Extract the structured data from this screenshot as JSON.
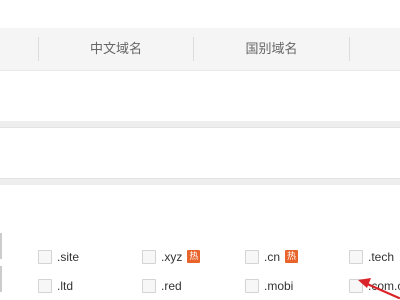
{
  "tabs": [
    {
      "label": ""
    },
    {
      "label": "中文域名"
    },
    {
      "label": "国别域名"
    },
    {
      "label": ""
    }
  ],
  "tlds": [
    {
      "label": ".site",
      "hot": false
    },
    {
      "label": ".xyz",
      "hot": true
    },
    {
      "label": ".cn",
      "hot": true
    },
    {
      "label": ".tech",
      "hot": false
    },
    {
      "label": ".ltd",
      "hot": false
    },
    {
      "label": ".red",
      "hot": false
    },
    {
      "label": ".mobi",
      "hot": false
    },
    {
      "label": ".com.c",
      "hot": false
    }
  ],
  "hot_badge_text": "热",
  "colors": {
    "hot_badge": "#e8642b",
    "annotation_arrow": "#d9252a",
    "tab_bar": "#f5f5f5",
    "band": "#eeeeee"
  },
  "icons": {
    "annotation": "red-arrow-icon",
    "checkbox": "checkbox-icon"
  }
}
